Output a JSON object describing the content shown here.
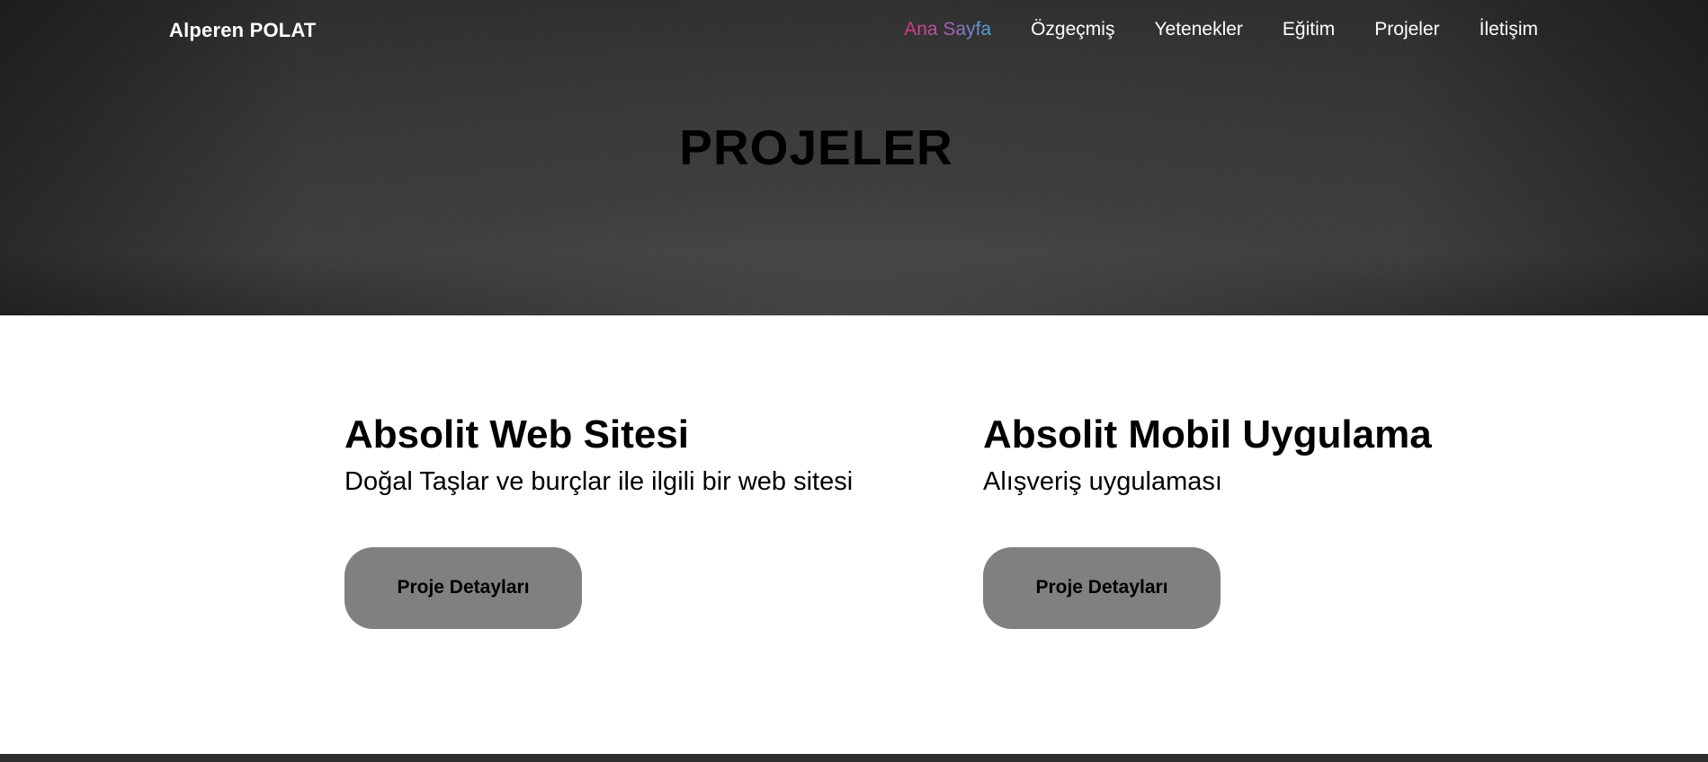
{
  "navbar": {
    "brand": "Alperen POLAT",
    "links": [
      {
        "label": "Ana Sayfa",
        "active": true
      },
      {
        "label": "Özgeçmiş",
        "active": false
      },
      {
        "label": "Yetenekler",
        "active": false
      },
      {
        "label": "Eğitim",
        "active": false
      },
      {
        "label": "Projeler",
        "active": false
      },
      {
        "label": "İletişim",
        "active": false
      }
    ],
    "active_gradient": [
      "#d9357a",
      "#a95fb5",
      "#4aa7d6"
    ]
  },
  "hero": {
    "title": "PROJELER"
  },
  "projects": [
    {
      "title": "Absolit Web Sitesi",
      "description": "Doğal Taşlar ve burçlar ile ilgili bir web sitesi",
      "button_label": "Proje Detayları"
    },
    {
      "title": "Absolit Mobil Uygulama",
      "description": "Alışveriş uygulaması",
      "button_label": "Proje Detayları"
    }
  ],
  "colors": {
    "button_bg": "#808080",
    "hero_bg": "#333333",
    "footer": "#2f2f2f"
  }
}
